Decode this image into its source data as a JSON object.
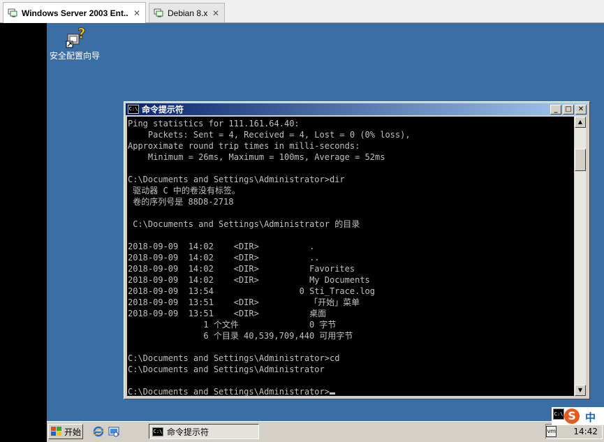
{
  "tabs": [
    {
      "label": "Windows Server 2003 Ent...",
      "active": true
    },
    {
      "label": "Debian 8.x",
      "active": false
    }
  ],
  "desktop": {
    "icons": [
      {
        "label": "安全配置向导",
        "icon": "security-wizard-icon"
      }
    ],
    "background": "#3a6ea5"
  },
  "cmd_window": {
    "title": "命令提示符",
    "icon_text": "C:\\",
    "lines": [
      "Ping statistics for 111.161.64.40:",
      "    Packets: Sent = 4, Received = 4, Lost = 0 (0% loss),",
      "Approximate round trip times in milli-seconds:",
      "    Minimum = 26ms, Maximum = 100ms, Average = 52ms",
      "",
      "C:\\Documents and Settings\\Administrator>dir",
      " 驱动器 C 中的卷没有标签。",
      " 卷的序列号是 88D8-2718",
      "",
      " C:\\Documents and Settings\\Administrator 的目录",
      "",
      "2018-09-09  14:02    <DIR>          .",
      "2018-09-09  14:02    <DIR>          ..",
      "2018-09-09  14:02    <DIR>          Favorites",
      "2018-09-09  14:02    <DIR>          My Documents",
      "2018-09-09  13:54                 0 Sti_Trace.log",
      "2018-09-09  13:51    <DIR>          「开始」菜单",
      "2018-09-09  13:51    <DIR>          桌面",
      "               1 个文件              0 字节",
      "               6 个目录 40,539,709,440 可用字节",
      "",
      "C:\\Documents and Settings\\Administrator>cd",
      "C:\\Documents and Settings\\Administrator",
      "",
      "C:\\Documents and Settings\\Administrator>"
    ],
    "colors": {
      "background": "#000000",
      "text": "#c0c0c0"
    }
  },
  "taskbar": {
    "start_label": "开始",
    "task_button_label": "命令提示符",
    "clock": "14:42"
  },
  "ime": {
    "logo": "S",
    "mode": "中",
    "brand_color": "#e85a1b"
  }
}
